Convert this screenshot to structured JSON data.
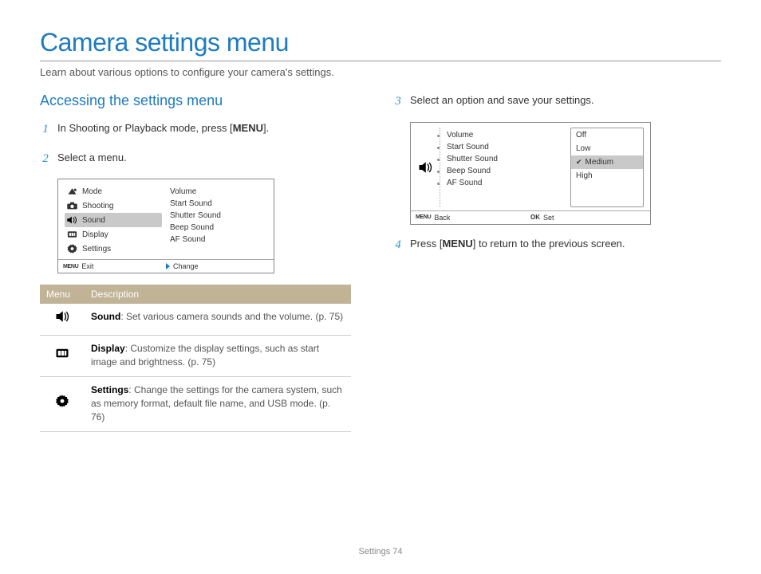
{
  "title": "Camera settings menu",
  "intro": "Learn about various options to configure your camera's settings.",
  "section_heading": "Accessing the settings menu",
  "steps": {
    "s1_pre": "In Shooting or Playback mode, press [",
    "s1_menu": "MENU",
    "s1_post": "].",
    "s2": "Select a menu.",
    "s3": "Select an option and save your settings.",
    "s4_pre": "Press [",
    "s4_menu": "MENU",
    "s4_post": "] to return to the previous screen."
  },
  "shot1": {
    "left": {
      "mode": "Mode",
      "shooting": "Shooting",
      "sound": "Sound",
      "display": "Display",
      "settings": "Settings"
    },
    "right": {
      "volume": "Volume",
      "start": "Start Sound",
      "shutter": "Shutter Sound",
      "beep": "Beep Sound",
      "af": "AF Sound"
    },
    "foot_menu": "MENU",
    "foot_exit": "Exit",
    "foot_change": "Change"
  },
  "shot2": {
    "sub": {
      "volume": "Volume",
      "start": "Start Sound",
      "shutter": "Shutter Sound",
      "beep": "Beep Sound",
      "af": "AF Sound"
    },
    "opts": {
      "off": "Off",
      "low": "Low",
      "medium": "Medium",
      "high": "High"
    },
    "foot_menu": "MENU",
    "foot_back": "Back",
    "foot_ok": "OK",
    "foot_set": "Set"
  },
  "table": {
    "h_menu": "Menu",
    "h_desc": "Description",
    "r1_b": "Sound",
    "r1_t": ": Set various camera sounds and the volume. (p. 75)",
    "r2_b": "Display",
    "r2_t": ": Customize the display settings, such as start image and brightness. (p. 75)",
    "r3_b": "Settings",
    "r3_t": ": Change the settings for the camera system, such as memory format, default file name, and USB mode. (p. 76)"
  },
  "footer_label": "Settings",
  "footer_page": "74"
}
